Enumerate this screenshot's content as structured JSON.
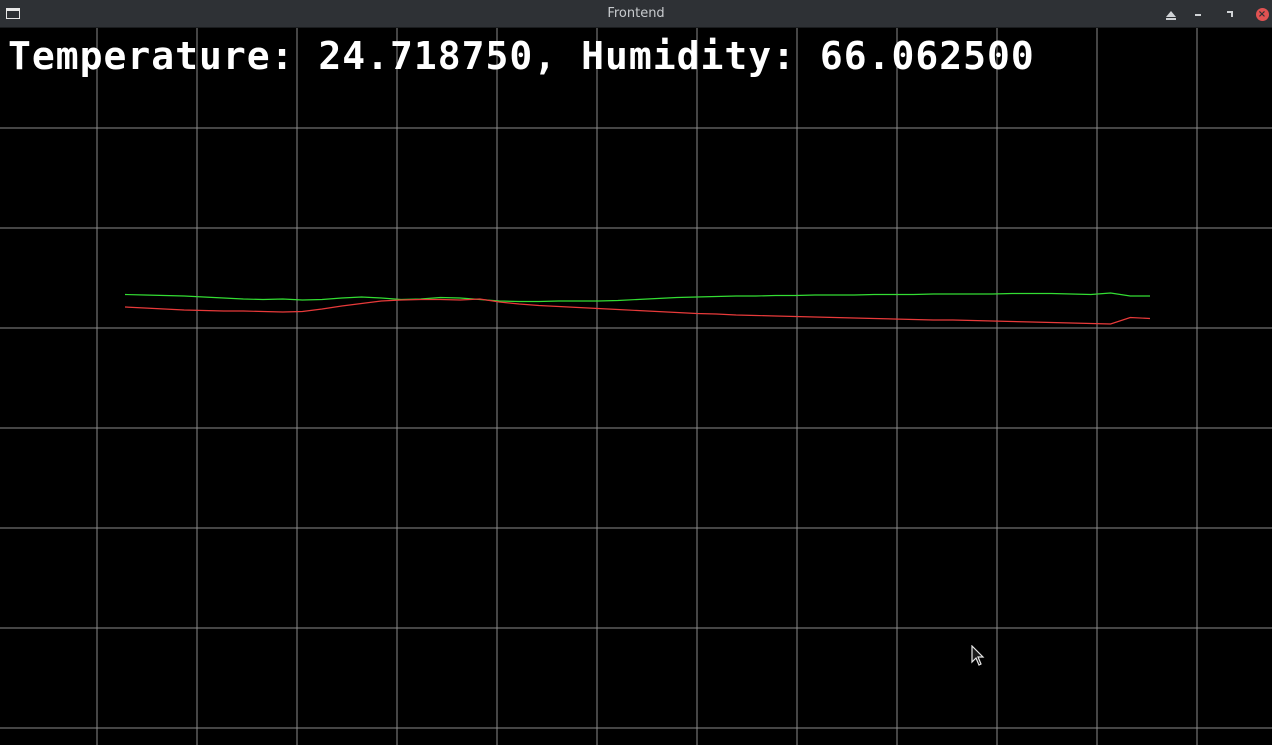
{
  "window": {
    "title": "Frontend"
  },
  "readout": {
    "text": "Temperature: 24.718750, Humidity: 66.062500"
  },
  "colors": {
    "background": "#000000",
    "grid": "#8a8a8a",
    "humidity_series": "#33dd33",
    "temperature_series": "#e83a3a",
    "text": "#ffffff"
  },
  "chart_data": {
    "type": "line",
    "grid": true,
    "series": [
      {
        "color": "#33dd33",
        "values": [
          66.1,
          66.0,
          65.9,
          65.8,
          65.6,
          65.4,
          65.2,
          65.1,
          65.2,
          65.0,
          65.1,
          65.4,
          65.6,
          65.4,
          65.1,
          65.2,
          65.5,
          65.4,
          65.1,
          64.8,
          64.7,
          64.7,
          64.8,
          64.8,
          64.8,
          64.9,
          65.1,
          65.3,
          65.5,
          65.6,
          65.7,
          65.8,
          65.8,
          65.9,
          65.9,
          66.0,
          66.0,
          66.0,
          66.1,
          66.1,
          66.1,
          66.2,
          66.2,
          66.2,
          66.2,
          66.3,
          66.3,
          66.3,
          66.2,
          66.1,
          66.4,
          65.8,
          65.8
        ]
      },
      {
        "color": "#e83a3a",
        "values": [
          63.6,
          63.4,
          63.2,
          63.0,
          62.9,
          62.8,
          62.8,
          62.7,
          62.6,
          62.7,
          63.2,
          63.8,
          64.3,
          64.8,
          65.0,
          65.1,
          65.1,
          65.0,
          65.2,
          64.6,
          64.2,
          63.9,
          63.7,
          63.5,
          63.3,
          63.1,
          62.9,
          62.7,
          62.5,
          62.3,
          62.2,
          62.0,
          61.9,
          61.8,
          61.7,
          61.6,
          61.5,
          61.4,
          61.3,
          61.2,
          61.1,
          61.0,
          61.0,
          60.9,
          60.8,
          60.7,
          60.6,
          60.5,
          60.4,
          60.3,
          60.2,
          61.5,
          61.3
        ]
      }
    ]
  }
}
